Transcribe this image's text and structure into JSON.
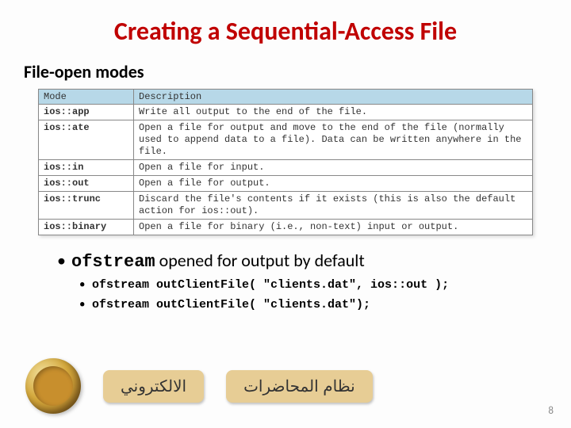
{
  "title": "Creating a Sequential-Access File",
  "subhead": "File-open modes",
  "table": {
    "headers": [
      "Mode",
      "Description"
    ],
    "rows": [
      {
        "mode": "ios::app",
        "desc": "Write all output to the end of the file."
      },
      {
        "mode": "ios::ate",
        "desc": "Open a file for output and move to the end of the file (normally used to append data to a file). Data can be written anywhere in the file."
      },
      {
        "mode": "ios::in",
        "desc": "Open a file for input."
      },
      {
        "mode": "ios::out",
        "desc": "Open a file for output."
      },
      {
        "mode": "ios::trunc",
        "desc": "Discard the file's contents if it exists (this is also the default action for ios::out)."
      },
      {
        "mode": "ios::binary",
        "desc": "Open a file for binary (i.e., non-text) input or output."
      }
    ]
  },
  "bullet": {
    "code_word": "ofstream",
    "rest": " opened for output by default",
    "sub": [
      "ofstream outClientFile( \"clients.dat\", ios::out );",
      "ofstream outClientFile( \"clients.dat\");"
    ]
  },
  "footer": {
    "word1": "الالكتروني",
    "word2": "نظام المحاضرات"
  },
  "page_number": "8"
}
